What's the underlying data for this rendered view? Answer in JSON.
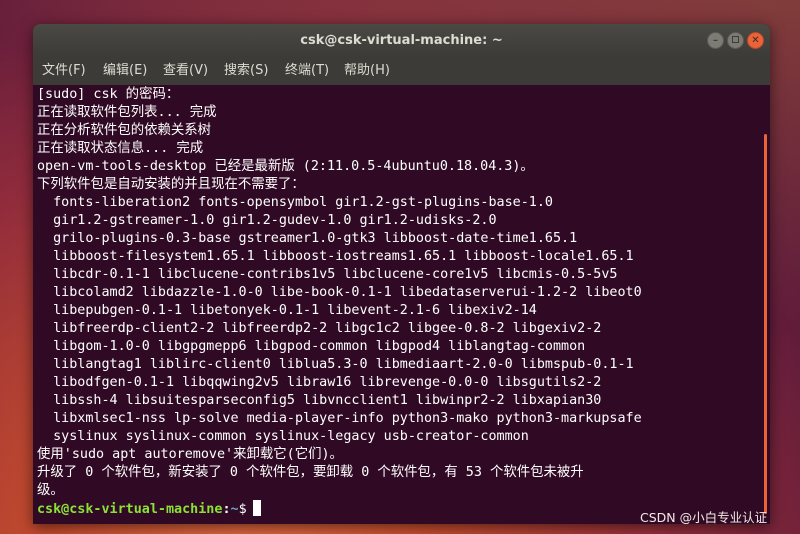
{
  "window": {
    "title": "csk@csk-virtual-machine: ~",
    "controls": {
      "minimize_glyph": "–",
      "close_glyph": "✕"
    }
  },
  "menu": {
    "items": [
      {
        "label": "文件(F)"
      },
      {
        "label": "编辑(E)"
      },
      {
        "label": "查看(V)"
      },
      {
        "label": "搜索(S)"
      },
      {
        "label": "终端(T)"
      },
      {
        "label": "帮助(H)"
      }
    ]
  },
  "terminal": {
    "lines": [
      "[sudo] csk 的密码：",
      "正在读取软件包列表... 完成",
      "正在分析软件包的依赖关系树",
      "正在读取状态信息... 完成",
      "open-vm-tools-desktop 已经是最新版 (2:11.0.5-4ubuntu0.18.04.3)。",
      "下列软件包是自动安装的并且现在不需要了：",
      "  fonts-liberation2 fonts-opensymbol gir1.2-gst-plugins-base-1.0",
      "  gir1.2-gstreamer-1.0 gir1.2-gudev-1.0 gir1.2-udisks-2.0",
      "  grilo-plugins-0.3-base gstreamer1.0-gtk3 libboost-date-time1.65.1",
      "  libboost-filesystem1.65.1 libboost-iostreams1.65.1 libboost-locale1.65.1",
      "  libcdr-0.1-1 libclucene-contribs1v5 libclucene-core1v5 libcmis-0.5-5v5",
      "  libcolamd2 libdazzle-1.0-0 libe-book-0.1-1 libedataserverui-1.2-2 libeot0",
      "  libepubgen-0.1-1 libetonyek-0.1-1 libevent-2.1-6 libexiv2-14",
      "  libfreerdp-client2-2 libfreerdp2-2 libgc1c2 libgee-0.8-2 libgexiv2-2",
      "  libgom-1.0-0 libgpgmepp6 libgpod-common libgpod4 liblangtag-common",
      "  liblangtag1 liblirc-client0 liblua5.3-0 libmediaart-2.0-0 libmspub-0.1-1",
      "  libodfgen-0.1-1 libqqwing2v5 libraw16 librevenge-0.0-0 libsgutils2-2",
      "  libssh-4 libsuitesparseconfig5 libvncclient1 libwinpr2-2 libxapian30",
      "  libxmlsec1-nss lp-solve media-player-info python3-mako python3-markupsafe",
      "  syslinux syslinux-common syslinux-legacy usb-creator-common",
      "使用'sudo apt autoremove'来卸载它(它们)。",
      "升级了 0 个软件包，新安装了 0 个软件包，要卸载 0 个软件包，有 53 个软件包未被升",
      "级。"
    ],
    "prompt": {
      "user_host": "csk@csk-virtual-machine",
      "colon": ":",
      "path": "~",
      "dollar": "$"
    }
  },
  "watermark": "CSDN @小白专业认证",
  "colors": {
    "terminal_bg": "#300a24",
    "titlebar_bg": "#3c3b37",
    "prompt_user": "#8ae234",
    "prompt_path": "#729fcf",
    "close_button": "#e9643a",
    "scrollbar": "#e9643a"
  }
}
